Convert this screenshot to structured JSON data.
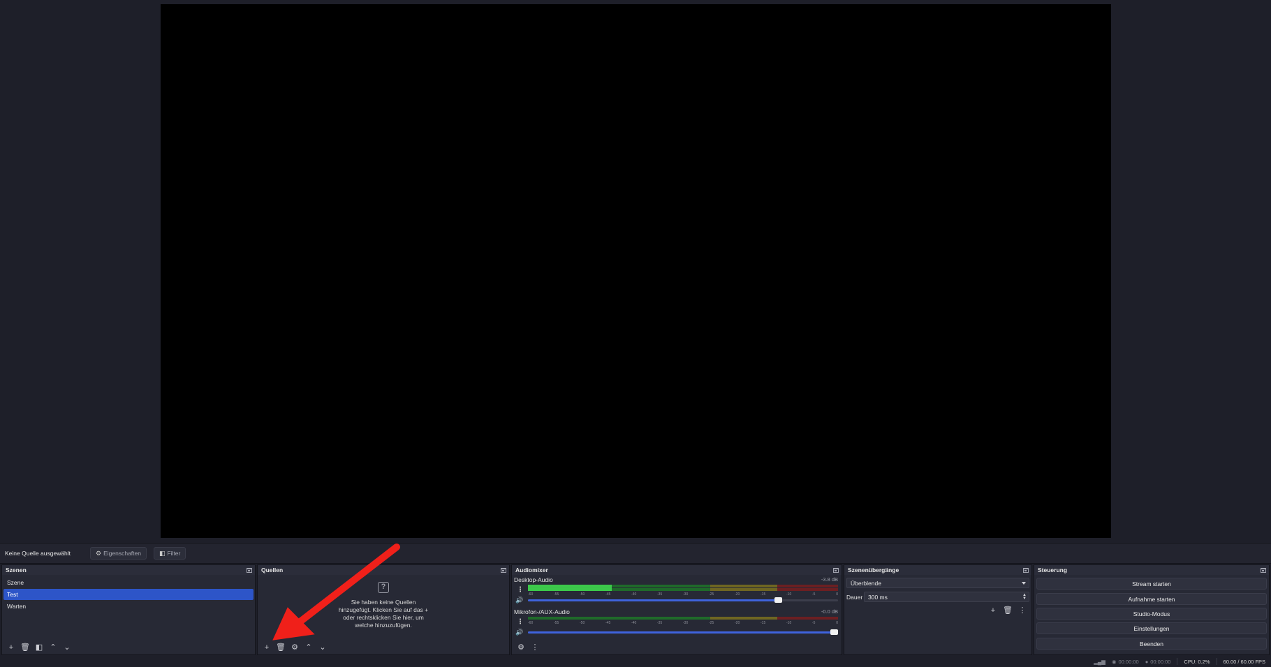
{
  "context_bar": {
    "no_source": "Keine Quelle ausgewählt",
    "properties_label": "Eigenschaften",
    "filter_label": "Filter"
  },
  "scenes": {
    "title": "Szenen",
    "items": [
      {
        "label": "Szene",
        "selected": false
      },
      {
        "label": "Test",
        "selected": true
      },
      {
        "label": "Warten",
        "selected": false
      }
    ]
  },
  "sources": {
    "title": "Quellen",
    "empty_message": "Sie haben keine Quellen hinzugefügt. Klicken Sie auf das + oder rechtsklicken Sie hier, um welche hinzuzufügen."
  },
  "mixer": {
    "title": "Audiomixer",
    "channels": [
      {
        "name": "Desktop-Audio",
        "db": "-3.8 dB",
        "level": 0.27,
        "volume": 0.82
      },
      {
        "name": "Mikrofon-/AUX-Audio",
        "db": "-0.0 dB",
        "level": 0.0,
        "volume": 1.0
      }
    ],
    "ticks": [
      "-60",
      "-55",
      "-50",
      "-45",
      "-40",
      "-35",
      "-30",
      "-25",
      "-20",
      "-15",
      "-10",
      "-5",
      "0"
    ]
  },
  "transitions": {
    "title": "Szenenübergänge",
    "selected": "Überblende",
    "duration_label": "Dauer",
    "duration_value": "300 ms"
  },
  "controls": {
    "title": "Steuerung",
    "buttons": [
      "Stream starten",
      "Aufnahme starten",
      "Studio-Modus",
      "Einstellungen",
      "Beenden"
    ]
  },
  "status": {
    "stream_time": "00:00:00",
    "rec_time": "00:00:00",
    "cpu": "CPU: 0.2%",
    "fps": "60.00 / 60.00 FPS"
  },
  "colors": {
    "accent": "#2d55c8",
    "annotation_arrow": "#f0201a"
  }
}
